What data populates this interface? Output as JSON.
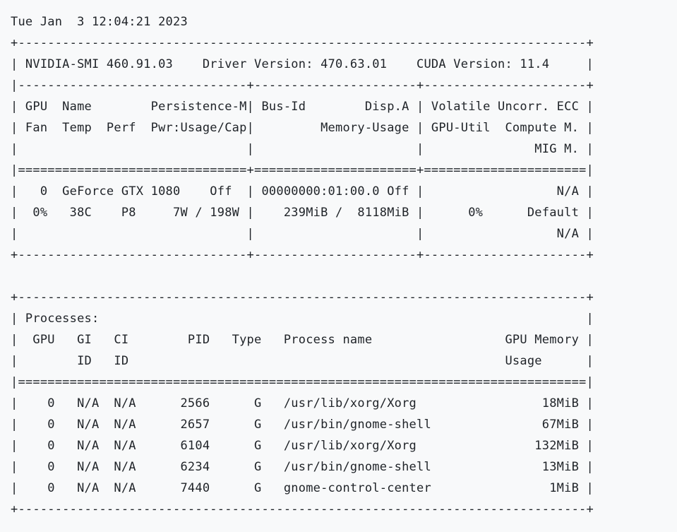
{
  "output_lines": [
    "Tue Jan  3 12:04:21 2023",
    "+-----------------------------------------------------------------------------+",
    "| NVIDIA-SMI 460.91.03    Driver Version: 470.63.01    CUDA Version: 11.4     |",
    "|-------------------------------+----------------------+----------------------+",
    "| GPU  Name        Persistence-M| Bus-Id        Disp.A | Volatile Uncorr. ECC |",
    "| Fan  Temp  Perf  Pwr:Usage/Cap|         Memory-Usage | GPU-Util  Compute M. |",
    "|                               |                      |               MIG M. |",
    "|===============================+======================+======================|",
    "|   0  GeForce GTX 1080    Off  | 00000000:01:00.0 Off |                  N/A |",
    "|  0%   38C    P8     7W / 198W |    239MiB /  8118MiB |      0%      Default |",
    "|                               |                      |                  N/A |",
    "+-------------------------------+----------------------+----------------------+",
    "",
    "+-----------------------------------------------------------------------------+",
    "| Processes:                                                                  |",
    "|  GPU   GI   CI        PID   Type   Process name                  GPU Memory |",
    "|        ID   ID                                                   Usage      |",
    "|=============================================================================|",
    "|    0   N/A  N/A      2566      G   /usr/lib/xorg/Xorg                 18MiB |",
    "|    0   N/A  N/A      2657      G   /usr/bin/gnome-shell               67MiB |",
    "|    0   N/A  N/A      6104      G   /usr/lib/xorg/Xorg                132MiB |",
    "|    0   N/A  N/A      6234      G   /usr/bin/gnome-shell               13MiB |",
    "|    0   N/A  N/A      7440      G   gnome-control-center                1MiB |",
    "+-----------------------------------------------------------------------------+"
  ]
}
